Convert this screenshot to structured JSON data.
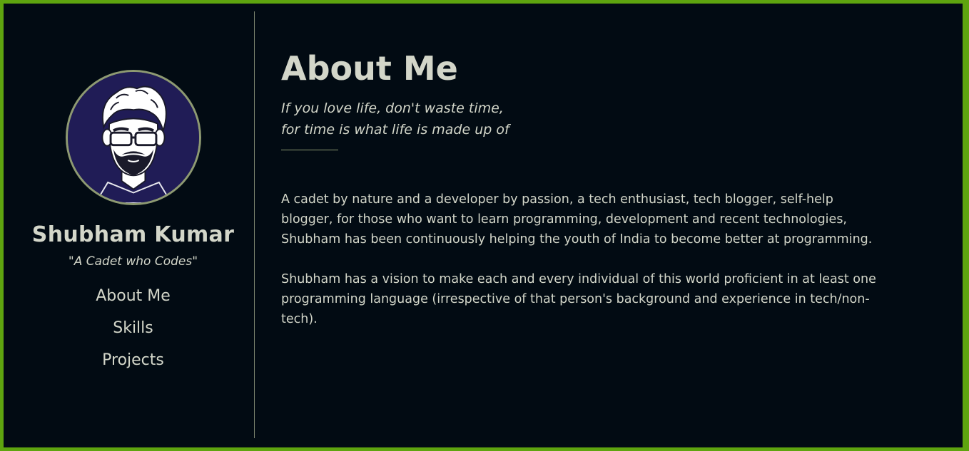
{
  "colors": {
    "border": "#5ea40f",
    "background": "#020b13",
    "text": "#d3d6c9",
    "avatar_bg": "#201c56",
    "avatar_ring": "#8e9a72"
  },
  "sidebar": {
    "avatar_icon": "bearded-man-glasses-avatar",
    "name": "Shubham Kumar",
    "tagline": "\"A Cadet who Codes\"",
    "nav": [
      {
        "label": "About Me"
      },
      {
        "label": "Skills"
      },
      {
        "label": "Projects"
      }
    ]
  },
  "main": {
    "title": "About Me",
    "quote_line1": "If you love life, don't waste time,",
    "quote_line2": "for time is what life is made up of",
    "paragraph1": " A cadet by nature and a developer by passion, a tech enthusiast, tech blogger, self-help\nblogger, for those who want to learn programming, development and recent technologies,\nShubham has been continuously helping the youth of India to become better at programming.",
    "paragraph2": "Shubham has a vision to  make each and every individual of this world proficient in at least one\nprogramming language (irrespective of that person's background and experience in tech/non-\ntech)."
  }
}
